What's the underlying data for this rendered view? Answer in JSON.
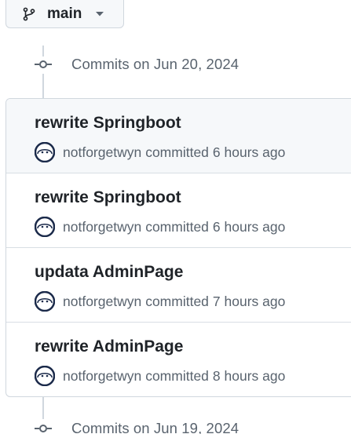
{
  "branch": {
    "icon": "git-branch-icon",
    "name": "main",
    "dropdown_icon": "triangle-down-icon"
  },
  "groups": [
    {
      "title": "Commits on Jun 20, 2024",
      "commits": [
        {
          "title": "rewrite Springboot",
          "author": "notforgetwyn",
          "action": "committed",
          "time": "6 hours ago"
        },
        {
          "title": "rewrite Springboot",
          "author": "notforgetwyn",
          "action": "committed",
          "time": "6 hours ago"
        },
        {
          "title": "updata AdminPage",
          "author": "notforgetwyn",
          "action": "committed",
          "time": "7 hours ago"
        },
        {
          "title": "rewrite AdminPage",
          "author": "notforgetwyn",
          "action": "committed",
          "time": "8 hours ago"
        }
      ]
    },
    {
      "title": "Commits on Jun 19, 2024"
    }
  ],
  "colors": {
    "border": "#d0d7de",
    "muted_text": "#59636e",
    "text": "#1f2328",
    "hover_row": "#f6f8fa",
    "avatar_dark": "#1b2a4a"
  }
}
